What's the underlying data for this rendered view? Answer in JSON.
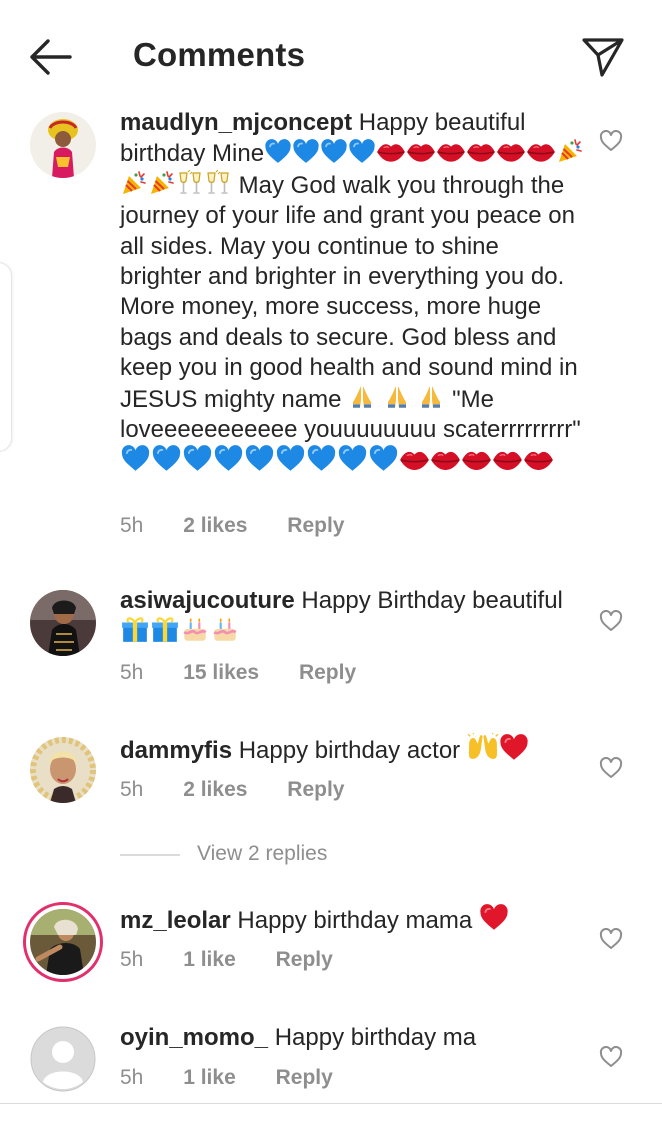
{
  "header": {
    "title": "Comments",
    "back_icon": "arrow-left-icon",
    "share_icon": "paper-plane-icon"
  },
  "comments": [
    {
      "username": "maudlyn_mjconcept",
      "text_1": "Happy beautiful birthday Mine",
      "text_2": "May God walk you through the journey of your life and grant you peace on all sides. May you continue to shine brighter and brighter in everything you do. More money, more success, more huge bags and deals to secure. God bless and keep you in good health and sound mind in JESUS mighty name",
      "text_3": "\"Me loveeeeeeeeeee youuuuuuuu scaterrrrrrrrr\"",
      "time": "5h",
      "likes": "2 likes",
      "reply": "Reply"
    },
    {
      "username": "asiwajucouture",
      "text_1": "Happy Birthday beautiful",
      "time": "5h",
      "likes": "15 likes",
      "reply": "Reply"
    },
    {
      "username": "dammyfis",
      "text_1": "Happy birthday actor",
      "time": "5h",
      "likes": "2 likes",
      "reply": "Reply"
    },
    {
      "username": "mz_leolar",
      "text_1": "Happy birthday mama",
      "time": "5h",
      "likes": "1 like",
      "reply": "Reply"
    },
    {
      "username": "oyin_momo_",
      "text_1": "Happy birthday ma",
      "time": "5h",
      "likes": "1 like",
      "reply": "Reply"
    }
  ],
  "view_replies": "View 2 replies",
  "colors": {
    "text": "#262626",
    "secondary": "#8e8e8e",
    "heart_blue": "#1e88e5",
    "red": "#e0162b",
    "story_ring": "#e1306c"
  }
}
